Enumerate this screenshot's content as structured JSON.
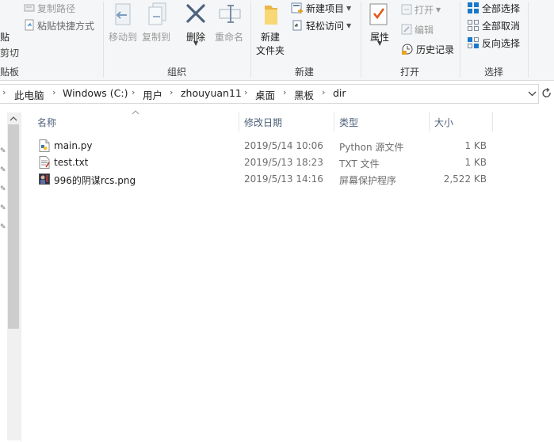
{
  "ribbon": {
    "clipboard": {
      "paste_label": "贴",
      "cut_label": "剪切",
      "copy_path_label": "复制路径",
      "paste_shortcut_label": "粘贴快捷方式",
      "group_label": "贴板"
    },
    "organize": {
      "move_to_label": "移动到",
      "copy_to_label": "复制到",
      "delete_label": "删除",
      "rename_label": "重命名",
      "group_label": "组织"
    },
    "new": {
      "new_folder_label_1": "新建",
      "new_folder_label_2": "文件夹",
      "new_item_label": "新建项目",
      "easy_access_label": "轻松访问",
      "group_label": "新建"
    },
    "open": {
      "properties_label": "属性",
      "open_label": "打开",
      "edit_label": "编辑",
      "history_label": "历史记录",
      "group_label": "打开"
    },
    "select": {
      "select_all_label": "全部选择",
      "select_none_label": "全部取消",
      "invert_label": "反向选择",
      "group_label": "选择"
    }
  },
  "address": {
    "crumbs": [
      "此电脑",
      "Windows (C:)",
      "用户",
      "zhouyuan11",
      "桌面",
      "黑板",
      "dir"
    ]
  },
  "columns": {
    "name": "名称",
    "modified": "修改日期",
    "type": "类型",
    "size": "大小"
  },
  "files": [
    {
      "name": "main.py",
      "modified": "2019/5/14 10:06",
      "type": "Python 源文件",
      "size": "1 KB",
      "icon": "python-file-icon"
    },
    {
      "name": "test.txt",
      "modified": "2019/5/13 18:23",
      "type": "TXT 文件",
      "size": "1 KB",
      "icon": "text-file-icon"
    },
    {
      "name": "996的阴谋rcs.png",
      "modified": "2019/5/13 14:16",
      "type": "屏幕保护程序",
      "size": "2,522 KB",
      "icon": "image-file-icon"
    }
  ],
  "colors": {
    "accent": "#1979ca",
    "column_header": "#4c607a",
    "ribbon_bg": "#f5f6f7",
    "disabled": "#9a9a9a"
  }
}
